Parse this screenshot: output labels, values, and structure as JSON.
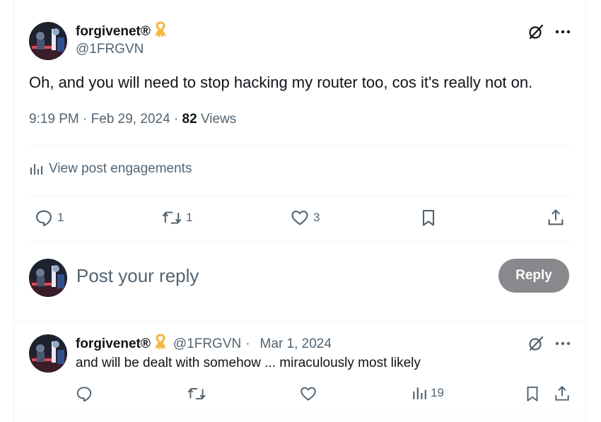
{
  "main_post": {
    "display_name": "forgivenet®",
    "handle": "@1FRGVN",
    "text": "Oh, and you will need to stop hacking my router too, cos it's really not on.",
    "time": "9:19 PM",
    "date": "Feb 29, 2024",
    "views_count": "82",
    "views_label": "Views",
    "engagements_label": "View post engagements",
    "replies": "1",
    "reposts": "1",
    "likes": "3"
  },
  "composer": {
    "placeholder": "Post your reply",
    "button_label": "Reply"
  },
  "reply_post": {
    "display_name": "forgivenet®",
    "handle": "@1FRGVN",
    "date": "Mar 1, 2024",
    "text": "and will be dealt with somehow ... miraculously most likely",
    "views": "19"
  },
  "icons": {
    "badge": "yellow-ribbon-icon",
    "grok": "grok-icon",
    "more": "more-icon",
    "engagements": "bar-chart-icon",
    "reply": "reply-icon",
    "repost": "repost-icon",
    "like": "heart-icon",
    "bookmark": "bookmark-icon",
    "share": "share-icon"
  },
  "colors": {
    "text_primary": "#0f1419",
    "text_secondary": "#536471",
    "divider": "#eff3f4",
    "reply_button_bg": "#87898c",
    "ribbon": "#f4b942"
  }
}
